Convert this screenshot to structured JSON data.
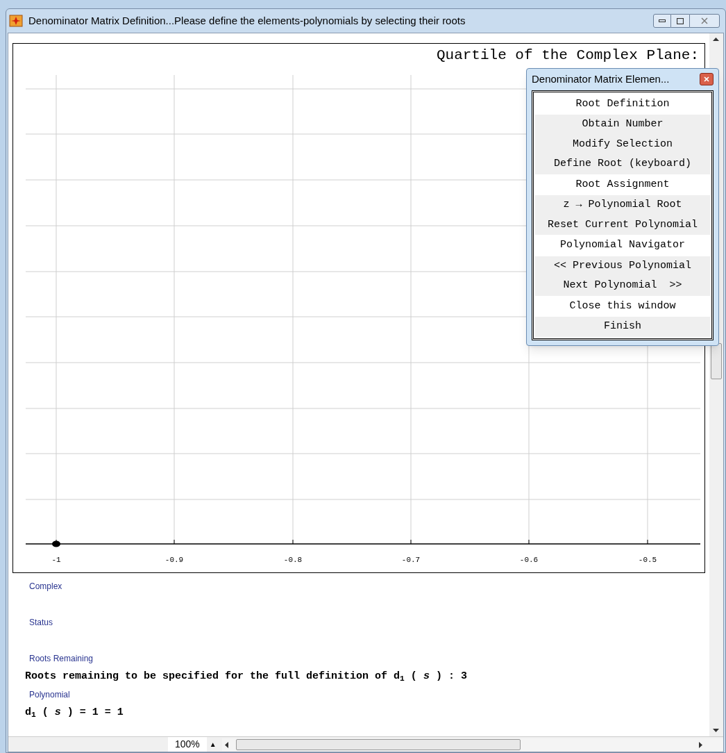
{
  "window": {
    "title": "Denominator Matrix Definition...Please define the elements-polynomials by selecting their roots"
  },
  "plot": {
    "title": "Quartile of the Complex Plane:",
    "x_ticks": [
      "-1",
      "-0.9",
      "-0.8",
      "-0.7",
      "-0.6",
      "-0.5"
    ]
  },
  "palette": {
    "title": "Denominator Matrix Elemen...",
    "rows": [
      {
        "kind": "section",
        "label": "Root Definition"
      },
      {
        "kind": "action",
        "label": "Obtain Number"
      },
      {
        "kind": "action",
        "label": "Modify Selection"
      },
      {
        "kind": "action",
        "label": "Define Root (keyboard)"
      },
      {
        "kind": "section",
        "label": "Root Assignment"
      },
      {
        "kind": "action",
        "label": "z → Polynomial Root"
      },
      {
        "kind": "action",
        "label": "Reset Current Polynomial"
      },
      {
        "kind": "section",
        "label": "Polynomial Navigator"
      },
      {
        "kind": "action",
        "label": "<< Previous Polynomial"
      },
      {
        "kind": "action",
        "label": "Next Polynomial  >>"
      },
      {
        "kind": "section",
        "label": "Close this window"
      },
      {
        "kind": "action",
        "label": "Finish"
      }
    ]
  },
  "fields": [
    {
      "label": "Complex"
    },
    {
      "label": "Status"
    },
    {
      "label": "Roots Remaining",
      "value": "Roots remaining to be specified for the full definition of d$_{1}$ ( *s* )  : 3"
    },
    {
      "label": "Polynomial",
      "value": "d$_{1}$ ( *s* ) = 1 = 1"
    }
  ],
  "status_bar": {
    "zoom": "100%",
    "zoom_arrow": "▲"
  }
}
